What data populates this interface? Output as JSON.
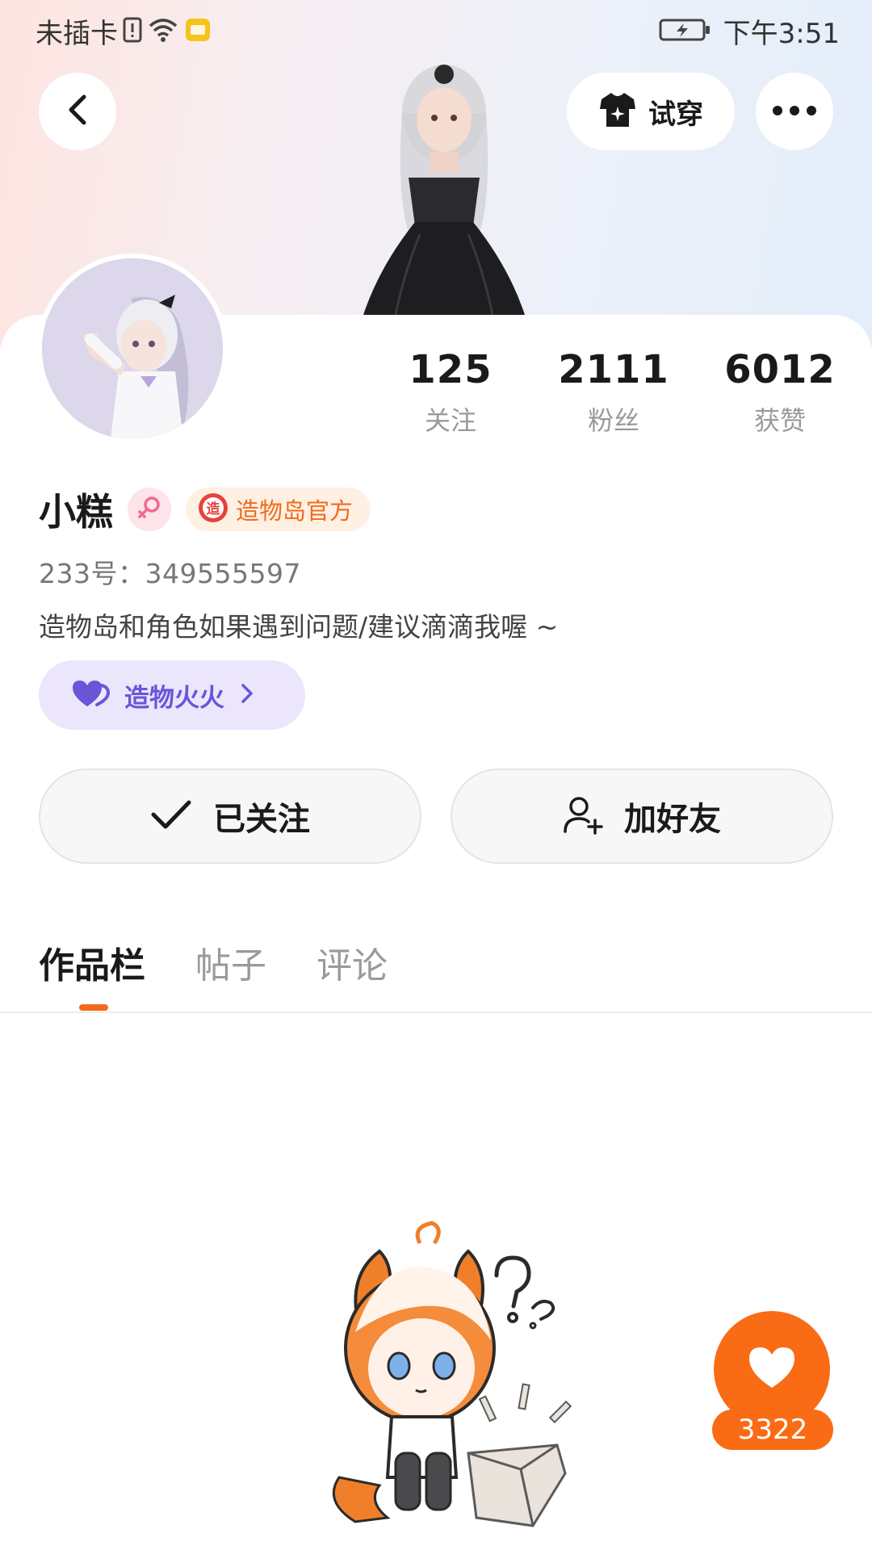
{
  "status_bar": {
    "carrier": "未插卡",
    "time": "下午3:51"
  },
  "nav": {
    "try_on_label": "试穿"
  },
  "stats": [
    {
      "value": "125",
      "label": "关注"
    },
    {
      "value": "2111",
      "label": "粉丝"
    },
    {
      "value": "6012",
      "label": "获赞"
    }
  ],
  "profile": {
    "username": "小糕",
    "official_badge": "造物岛官方",
    "official_badge_icon_text": "造",
    "uid": "233号：349555597",
    "bio": "造物岛和角色如果遇到问题/建议滴滴我喔 ~",
    "fire_chip_label": "造物火火"
  },
  "actions": {
    "followed_label": "已关注",
    "add_friend_label": "加好友"
  },
  "tabs": [
    {
      "label": "作品栏",
      "active": true
    },
    {
      "label": "帖子",
      "active": false
    },
    {
      "label": "评论",
      "active": false
    }
  ],
  "like_fab": {
    "count": "3322"
  },
  "colors": {
    "accent_orange": "#fa6b16",
    "fire_purple": "#6a55d8",
    "gender_pink": "#f06a8e"
  }
}
